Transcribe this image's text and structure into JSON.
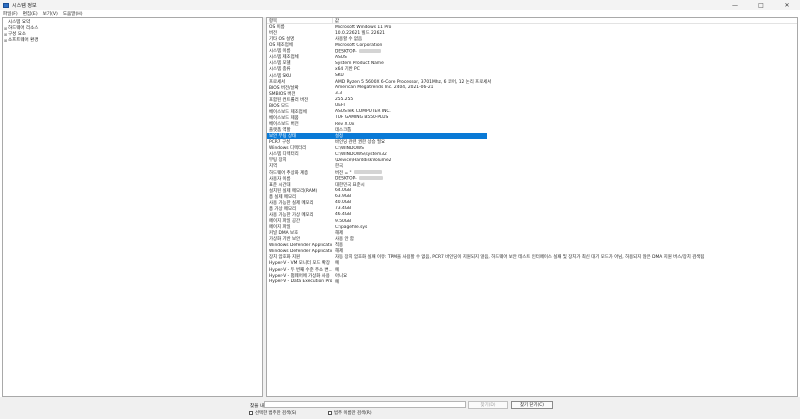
{
  "window": {
    "title": "시스템 정보",
    "controls": [
      "—",
      "□",
      "✕"
    ]
  },
  "menu": [
    {
      "label": "파일(F)"
    },
    {
      "label": "편집(E)"
    },
    {
      "label": "보기(V)"
    },
    {
      "label": "도움말(H)"
    }
  ],
  "tree": [
    {
      "label": "시스템 요약",
      "toggle": ""
    },
    {
      "label": "하드웨어 리소스",
      "toggle": "⊞"
    },
    {
      "label": "구성 요소",
      "toggle": "⊞"
    },
    {
      "label": "소프트웨어 환경",
      "toggle": "⊞"
    }
  ],
  "list": {
    "header": {
      "item": "항목",
      "value": "값"
    },
    "rows": [
      {
        "item": "OS 이름",
        "value": "Microsoft Windows 11 Pro"
      },
      {
        "item": "버전",
        "value": "10.0.22621 빌드 22621"
      },
      {
        "item": "기타 OS 설명",
        "value": "사용할 수 없음"
      },
      {
        "item": "OS 제조업체",
        "value": "Microsoft Corporation"
      },
      {
        "item": "시스템 이름",
        "value": "DESKTOP-",
        "redact": 22
      },
      {
        "item": "시스템 제조업체",
        "value": "ASUS"
      },
      {
        "item": "시스템 모델",
        "value": "System Product Name"
      },
      {
        "item": "시스템 종류",
        "value": "x64 기반 PC"
      },
      {
        "item": "시스템 SKU",
        "value": "SKU"
      },
      {
        "item": "프로세서",
        "value": "AMD Ryzen 5 5600X 6-Core Processor, 3701Mhz, 6 코어, 12 논리 프로세서"
      },
      {
        "item": "BIOS 버전/날짜",
        "value": "American Megatrends Inc. 2404, 2021-06-21"
      },
      {
        "item": "SMBIOS 버전",
        "value": "3.3"
      },
      {
        "item": "포함된 컨트롤러 버전",
        "value": "255.255"
      },
      {
        "item": "BIOS 모드",
        "value": "UEFI"
      },
      {
        "item": "베이스보드 제조업체",
        "value": "ASUSTeK COMPUTER INC."
      },
      {
        "item": "베이스보드 제품",
        "value": "TUF GAMING B550-PLUS"
      },
      {
        "item": "베이스보드 버전",
        "value": "Rev X.0x"
      },
      {
        "item": "플랫폼 역할",
        "value": "데스크톱"
      },
      {
        "item": "보안 부팅 상태",
        "value": "설정",
        "selected": true
      },
      {
        "item": "PCR7 구성",
        "value": "바인딩 관련 권한 상승 필요"
      },
      {
        "item": "Windows 디렉터리",
        "value": "C:\\WINDOWS"
      },
      {
        "item": "시스템 디렉터리",
        "value": "C:\\WINDOWS\\system32"
      },
      {
        "item": "부팅 장치",
        "value": "\\Device\\HarddiskVolume2"
      },
      {
        "item": "지역",
        "value": "한국"
      },
      {
        "item": "하드웨어 추상화 계층",
        "value": "버전 = \"",
        "redact": 28
      },
      {
        "item": "사용자 이름",
        "value": "DESKTOP-",
        "redact": 24
      },
      {
        "item": "표준 시간대",
        "value": "대한민국 표준시"
      },
      {
        "item": "설치된 실제 메모리(RAM)",
        "value": "64.0GB"
      },
      {
        "item": "총 실제 메모리",
        "value": "63.9GB"
      },
      {
        "item": "사용 가능한 실제 메모리",
        "value": "40.0GB"
      },
      {
        "item": "총 가상 메모리",
        "value": "73.4GB"
      },
      {
        "item": "사용 가능한 가상 메모리",
        "value": "46.4GB"
      },
      {
        "item": "페이지 파일 공간",
        "value": "9.50GB"
      },
      {
        "item": "페이지 파일",
        "value": "C:\\pagefile.sys"
      },
      {
        "item": "커널 DMA 보호",
        "value": "해제"
      },
      {
        "item": "가상화 기반 보안",
        "value": "사용 안 함"
      },
      {
        "item": "Windows Defender Applicatio...",
        "value": "적용"
      },
      {
        "item": "Windows Defender Applicatio...",
        "value": "해제"
      },
      {
        "item": "장치 암호화 지원",
        "value": "자동 장치 암호화 실패 이유: TPM을 사용할 수 없음, PCR7 바인딩이 지원되지 않음, 하드웨어 보안 테스트 인터페이스 실패 및 장치가 최신 대기 모드가 아님, 허용되지 않은 DMA 지원 버스/장치 검색됨"
      },
      {
        "item": "Hyper-V - VM 모니터 모드 확장",
        "value": "예"
      },
      {
        "item": "Hyper-V - 두 번째 수준 주소 변...",
        "value": "예"
      },
      {
        "item": "Hyper-V - 펌웨어에 가상화 사용",
        "value": "아니요"
      },
      {
        "item": "Hyper-V - Data Execution Prot...",
        "value": "예"
      }
    ]
  },
  "find": {
    "label": "찾을 내용(W):",
    "input_value": "",
    "find_button": "찾기(D)",
    "close_button": "찾기 닫기(C)",
    "check_selected": "선택한 범주만 검색(S)",
    "check_names": "범주 이름만 검색(R)"
  }
}
